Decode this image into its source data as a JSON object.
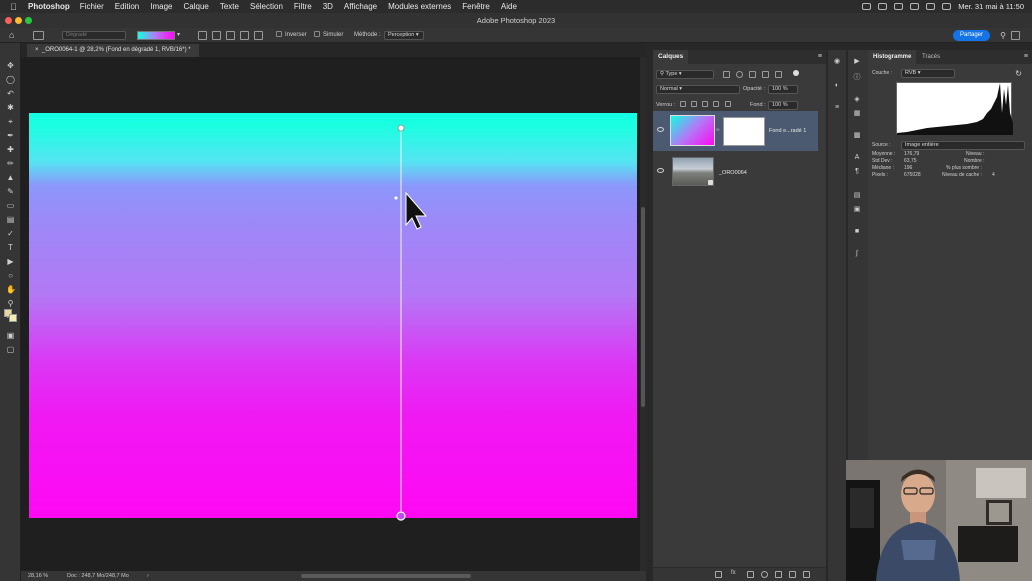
{
  "menubar": {
    "app_name": "Photoshop",
    "items": [
      "Fichier",
      "Edition",
      "Image",
      "Calque",
      "Texte",
      "Sélection",
      "Filtre",
      "3D",
      "Affichage",
      "Modules externes",
      "Fenêtre",
      "Aide"
    ],
    "datetime": "Mer. 31 mai à 11:50"
  },
  "titlebar": {
    "title": "Adobe Photoshop 2023"
  },
  "options": {
    "preset_placeholder": "Dégradé",
    "inverser": "Inverser",
    "simuler": "Simuler",
    "methode_label": "Méthode :",
    "methode_value": "Perception",
    "share": "Partager"
  },
  "document": {
    "tab_title": "_ORO0064-1 @ 28,2% (Fond en dégradé 1, RVB/16*) *",
    "zoom": "28,16 %",
    "doc_info": "Doc : 248,7 Mo/248,7 Mo"
  },
  "gradient": {
    "stops": [
      "#12ffe4",
      "#55e4f2",
      "#8c97fb",
      "#b378f5",
      "#dc36f5",
      "#ff08f4"
    ],
    "start_handle_color": "#ffffff",
    "end_handle_color": "#c04cf0"
  },
  "layers": {
    "panel_title": "Calques",
    "filter_label": "Type",
    "blend_mode": "Normal",
    "opacity_label": "Opacité :",
    "opacity_value": "100 %",
    "lock_label": "Verrou :",
    "fill_label": "Fond :",
    "fill_value": "100 %",
    "items": [
      {
        "name": "Fond e...radé 1",
        "selected": true
      },
      {
        "name": "_ORO0064",
        "selected": false
      }
    ]
  },
  "histogram": {
    "tab_active": "Histogramme",
    "tab_inactive": "Tracés",
    "channel_label": "Couche :",
    "channel_value": "RVB",
    "source_label": "Source :",
    "source_value": "Image entière",
    "stats_left": [
      {
        "label": "Moyenne :",
        "value": "176,79"
      },
      {
        "label": "Std Dev :",
        "value": "63,75"
      },
      {
        "label": "Médiane :",
        "value": "196"
      },
      {
        "label": "Pixels :",
        "value": "675028"
      }
    ],
    "stats_right": [
      {
        "label": "Niveau :",
        "value": ""
      },
      {
        "label": "Nombre :",
        "value": ""
      },
      {
        "label": "% plus sombre :",
        "value": ""
      },
      {
        "label": "Niveau de cache :",
        "value": "4"
      }
    ]
  }
}
